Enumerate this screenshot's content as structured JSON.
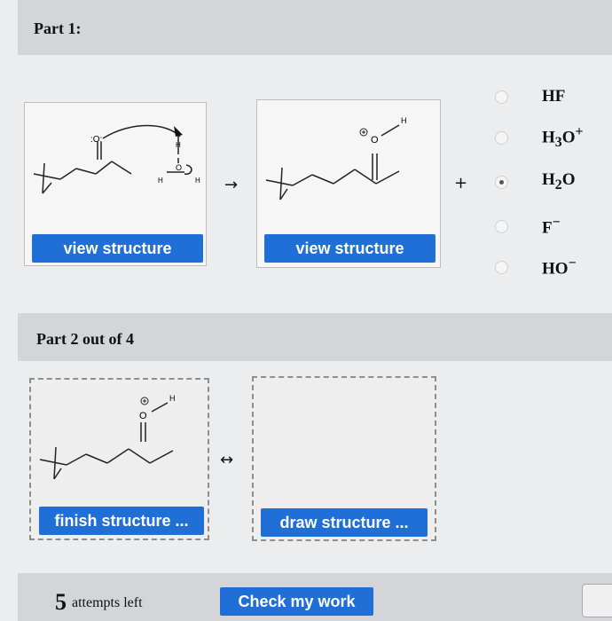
{
  "part1": {
    "title": "Part 1:",
    "reactant_button": "view structure",
    "product_button": "view structure",
    "reaction_arrow": "→",
    "plus": "+"
  },
  "options": [
    {
      "label_main": "HF",
      "selected": false
    },
    {
      "label_main": "H",
      "sub": "3",
      "after": "O",
      "sup": "+",
      "selected": false
    },
    {
      "label_main": "H",
      "sub": "2",
      "after": "O",
      "selected": true
    },
    {
      "label_main": "F",
      "sup": "−",
      "selected": false
    },
    {
      "label_main": "HO",
      "sup": "−",
      "selected": false
    }
  ],
  "part2": {
    "title": "Part 2 out of 4",
    "resonance_arrow": "↔",
    "finish_button": "finish structure ...",
    "draw_button": "draw structure ..."
  },
  "footer": {
    "attempts_number": "5",
    "attempts_text": "attempts left",
    "check_button": "Check my work"
  },
  "molecule_labels": {
    "O": "O",
    "H": "H",
    "lone_pairs": ":O:"
  },
  "colors": {
    "button_blue": "#1f6fd6",
    "band_gray": "#d3d5d8"
  }
}
